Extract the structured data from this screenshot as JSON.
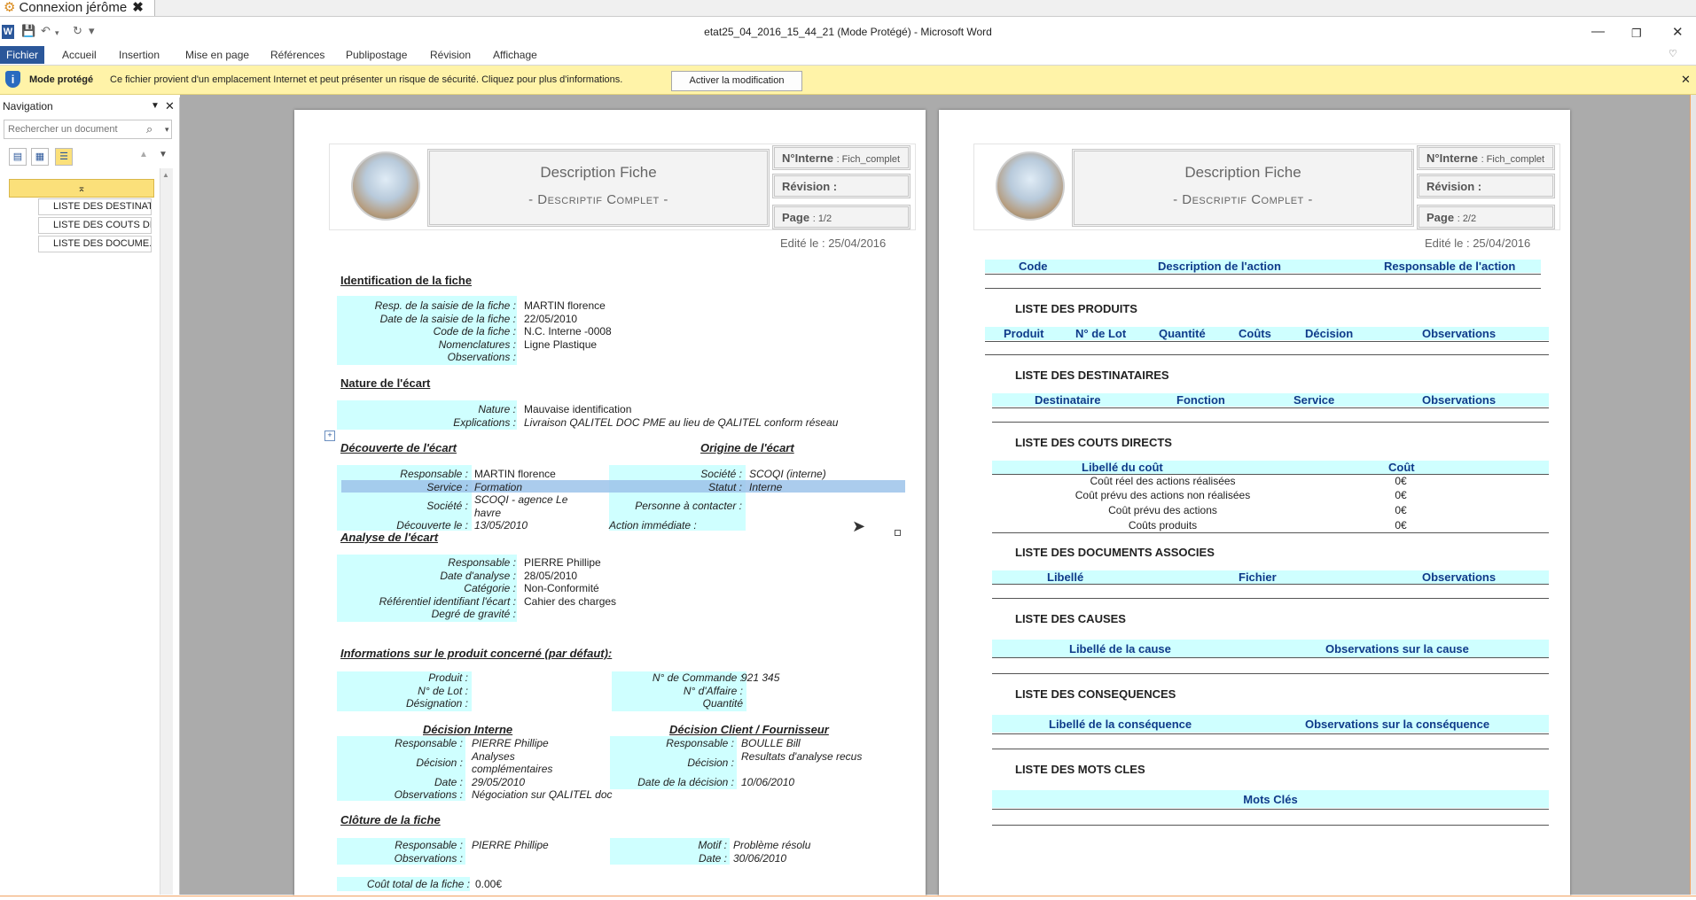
{
  "app": {
    "session_tab": "Connexion jérôme",
    "title": "etat25_04_2016_15_44_21 (Mode Protégé)  -  Microsoft Word",
    "word_icon": "W",
    "ribbon_tabs": [
      "Fichier",
      "Accueil",
      "Insertion",
      "Mise en page",
      "Références",
      "Publipostage",
      "Révision",
      "Affichage"
    ]
  },
  "protected": {
    "title": "Mode protégé",
    "message": "Ce fichier provient d'un emplacement Internet et peut présenter un risque de sécurité. Cliquez pour plus d'informations.",
    "button": "Activer la modification"
  },
  "nav": {
    "title": "Navigation",
    "search_placeholder": "Rechercher un document",
    "items": [
      "LISTE DES DESTINAT...",
      "LISTE DES COUTS DI...",
      "LISTE DES DOCUME..."
    ]
  },
  "header": {
    "title": "Description Fiche",
    "subtitle": "- Descriptif Complet -",
    "interne_label": "N°Interne",
    "interne_value": ": Fich_complet",
    "revision_label": "Révision :",
    "page_label": "Page",
    "page1": ": 1/2",
    "page2": ": 2/2",
    "edit_date": "Edité le : 25/04/2016"
  },
  "left": {
    "ident_title": "Identification  de la fiche",
    "ident": [
      {
        "l": "Resp. de la saisie de la fiche :",
        "v": "MARTIN florence"
      },
      {
        "l": "Date de la saisie de la fiche :",
        "v": "22/05/2010"
      },
      {
        "l": "Code de la fiche :",
        "v": "N.C. Interne -0008"
      },
      {
        "l": "Nomenclatures :",
        "v": "Ligne Plastique"
      },
      {
        "l": "Observations :",
        "v": ""
      }
    ],
    "nature_title": "Nature de l'écart",
    "nature": [
      {
        "l": "Nature :",
        "v": "Mauvaise identification"
      },
      {
        "l": "Explications :",
        "v": "Livraison QALITEL DOC PME au lieu de QALITEL conform réseau"
      }
    ],
    "decouverte_title": "Découverte de l'écart",
    "origine_title": "Origine de l'écart",
    "decouverte": [
      {
        "l": "Responsable :",
        "v": "MARTIN florence"
      },
      {
        "l": "Service :",
        "v": "Formation"
      },
      {
        "l": "Société :",
        "v": "SCOQI - agence Le havre"
      },
      {
        "l": "Découverte le :",
        "v": "13/05/2010"
      }
    ],
    "origine": [
      {
        "l": "Société :",
        "v": "SCOQI (interne)"
      },
      {
        "l": "Statut :",
        "v": "Interne"
      },
      {
        "l": "Personne à contacter :",
        "v": ""
      },
      {
        "l": "Action immédiate :",
        "v": ""
      }
    ],
    "analyse_title": "Analyse de l'écart",
    "analyse": [
      {
        "l": "Responsable :",
        "v": "PIERRE Phillipe"
      },
      {
        "l": "Date d'analyse :",
        "v": "28/05/2010"
      },
      {
        "l": "Catégorie :",
        "v": "Non-Conformité"
      },
      {
        "l": "Référentiel identifiant l'écart :",
        "v": "Cahier des charges"
      },
      {
        "l": "Degré de gravité :",
        "v": ""
      }
    ],
    "produit_title": "Informations sur le produit concerné (par défaut):",
    "produit_left": [
      {
        "l": "Produit :",
        "v": ""
      },
      {
        "l": "N° de Lot :",
        "v": ""
      },
      {
        "l": "Désignation :",
        "v": ""
      }
    ],
    "produit_right": [
      {
        "l": "N° de Commande :",
        "v": "921 345"
      },
      {
        "l": "N° d'Affaire :",
        "v": ""
      },
      {
        "l": "Quantité",
        "v": ""
      }
    ],
    "dec_int_title": "Décision Interne",
    "dec_cli_title": "Décision Client / Fournisseur",
    "dec_int": [
      {
        "l": "Responsable :",
        "v": "PIERRE Phillipe"
      },
      {
        "l": "Décision :",
        "v": "Analyses complémentaires"
      },
      {
        "l": "Date :",
        "v": "29/05/2010"
      },
      {
        "l": "Observations :",
        "v": "Négociation sur QALITEL doc"
      }
    ],
    "dec_cli": [
      {
        "l": "Responsable :",
        "v": "BOULLE Bill"
      },
      {
        "l": "Décision :",
        "v": "Resultats d'analyse recus"
      },
      {
        "l": "Date de la décision :",
        "v": "10/06/2010"
      }
    ],
    "cloture_title": "Clôture de la fiche",
    "cloture_left": [
      {
        "l": "Responsable :",
        "v": "PIERRE Phillipe"
      },
      {
        "l": "Observations :",
        "v": ""
      }
    ],
    "cloture_right": [
      {
        "l": "Motif :",
        "v": "Problème résolu"
      },
      {
        "l": "Date :",
        "v": "30/06/2010"
      }
    ],
    "cout_total_label": "Coût total de la fiche :",
    "cout_total_value": "0.00€"
  },
  "right": {
    "actions_cols": [
      "Code",
      "Description de l'action",
      "Responsable de l'action"
    ],
    "produits_title": "LISTE DES PRODUITS",
    "produits_cols": [
      "Produit",
      "N° de Lot",
      "Quantité",
      "Coûts",
      "Décision",
      "Observations"
    ],
    "destinataires_title": "LISTE DES DESTINATAIRES",
    "destinataires_cols": [
      "Destinataire",
      "Fonction",
      "Service",
      "Observations"
    ],
    "couts_title": "LISTE DES COUTS DIRECTS",
    "couts_cols": [
      "Libellé du coût",
      "Coût"
    ],
    "couts_rows": [
      {
        "l": "Coût réel des actions réalisées",
        "v": "0€"
      },
      {
        "l": "Coût prévu des actions non réalisées",
        "v": "0€"
      },
      {
        "l": "Coût prévu des actions",
        "v": "0€"
      },
      {
        "l": "Coûts produits",
        "v": "0€"
      }
    ],
    "documents_title": "LISTE DES DOCUMENTS ASSOCIES",
    "documents_cols": [
      "Libellé",
      "Fichier",
      "Observations"
    ],
    "causes_title": "LISTE DES CAUSES",
    "causes_cols": [
      "Libellé de la cause",
      "Observations sur la cause"
    ],
    "consequences_title": "LISTE DES CONSEQUENCES",
    "consequences_cols": [
      "Libellé de la conséquence",
      "Observations sur la conséquence"
    ],
    "motscles_title": "LISTE DES MOTS CLES",
    "motscles_cols": [
      "Mots Clés"
    ]
  }
}
